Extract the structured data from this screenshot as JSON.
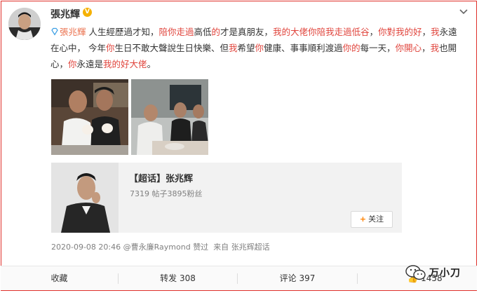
{
  "post": {
    "author": "張兆輝",
    "verified_badge": "V",
    "mention": "張兆輝",
    "segments": [
      {
        "t": " 人生經歷過才知，",
        "red": false
      },
      {
        "t": "陪你走過",
        "red": true
      },
      {
        "t": "高低",
        "red": false
      },
      {
        "t": "的",
        "red": true
      },
      {
        "t": "才是真朋友，",
        "red": false
      },
      {
        "t": "我的大佬你陪我走過低谷",
        "red": true
      },
      {
        "t": "，",
        "red": false
      },
      {
        "t": "你對我的好",
        "red": true
      },
      {
        "t": "，",
        "red": false
      },
      {
        "t": "我",
        "red": true
      },
      {
        "t": "永遠在心中，  今年",
        "red": false
      },
      {
        "t": "你",
        "red": true
      },
      {
        "t": "生日不敢大聲說生日快樂、但",
        "red": false
      },
      {
        "t": "我",
        "red": true
      },
      {
        "t": "希望",
        "red": false
      },
      {
        "t": "你",
        "red": true
      },
      {
        "t": "健康、事事順利渡過",
        "red": false
      },
      {
        "t": "你的",
        "red": true
      },
      {
        "t": "每一天，",
        "red": false
      },
      {
        "t": "你開心",
        "red": true
      },
      {
        "t": "，",
        "red": false
      },
      {
        "t": "我",
        "red": true
      },
      {
        "t": "也開心，",
        "red": false
      },
      {
        "t": "你",
        "red": true
      },
      {
        "t": "永遠是",
        "red": false
      },
      {
        "t": "我的好大佬",
        "red": true
      },
      {
        "t": "。",
        "red": false
      }
    ]
  },
  "topic_card": {
    "title": "【超话】张兆辉",
    "stats": "7319 帖子3895粉丝",
    "follow_label": "关注"
  },
  "meta": {
    "timestamp": "2020-09-08 20:46",
    "liked_by": "@曹永廉Raymond",
    "liked_suffix": "赞过",
    "source_prefix": "来自",
    "source": "张兆辉超话"
  },
  "actions": {
    "collect": "收藏",
    "repost": "转发 308",
    "comment": "评论 397",
    "like": "1458"
  },
  "watermark": "万小刀",
  "colors": {
    "accent_red": "#e0443c",
    "frame_red": "#e0302a",
    "link_orange": "#eb7350",
    "follow_plus": "#ff8200"
  },
  "icons": [
    "chevron-down-icon",
    "diamond-icon",
    "plus-icon",
    "like-icon",
    "wechat-icon"
  ]
}
